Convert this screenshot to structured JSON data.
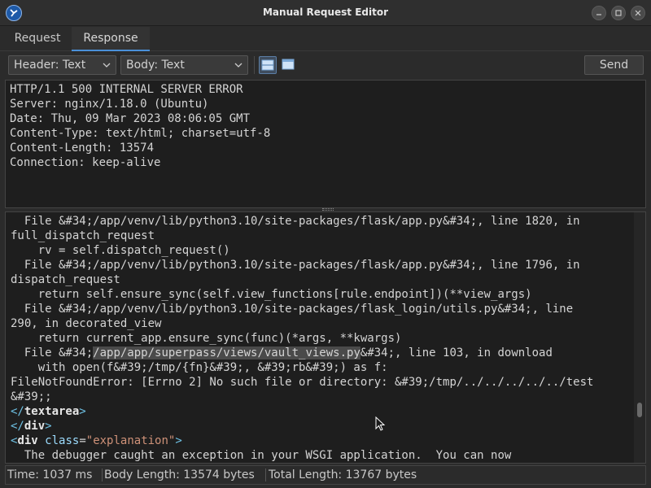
{
  "window": {
    "title": "Manual Request Editor"
  },
  "tabs": [
    {
      "label": "Request"
    },
    {
      "label": "Response"
    }
  ],
  "toolbar": {
    "header_view": "Header: Text",
    "body_view": "Body: Text",
    "send_label": "Send"
  },
  "response_header": {
    "lines": [
      "HTTP/1.1 500 INTERNAL SERVER ERROR",
      "Server: nginx/1.18.0 (Ubuntu)",
      "Date: Thu, 09 Mar 2023 08:06:05 GMT",
      "Content-Type: text/html; charset=utf-8",
      "Content-Length: 13574",
      "Connection: keep-alive"
    ]
  },
  "response_body": {
    "l1": "  File &#34;/app/venv/lib/python3.10/site-packages/flask/app.py&#34;, line 1820, in",
    "l2": "full_dispatch_request",
    "l3": "    rv = self.dispatch_request()",
    "l4": "  File &#34;/app/venv/lib/python3.10/site-packages/flask/app.py&#34;, line 1796, in",
    "l5": "dispatch_request",
    "l6": "    return self.ensure_sync(self.view_functions[rule.endpoint])(**view_args)",
    "l7": "  File &#34;/app/venv/lib/python3.10/site-packages/flask_login/utils.py&#34;, line",
    "l8": "290, in decorated_view",
    "l9": "    return current_app.ensure_sync(func)(*args, **kwargs)",
    "l10_pre": "  File &#34;",
    "l10_hl": "/app/app/superpass/views/vault_views.py",
    "l10_post": "&#34;, line 103, in download",
    "l11": "    with open(f&#39;/tmp/{fn}&#39;, &#39;rb&#39;) as f:",
    "l12": "FileNotFoundError: [Errno 2] No such file or directory: &#39;/tmp/../../../../../test",
    "l13": "&#39;;",
    "l14_open": "</",
    "l14_name": "textarea",
    "l14_close": ">",
    "l15_open": "</",
    "l15_name": "div",
    "l15_close": ">",
    "l16_open": "<",
    "l16_name": "div",
    "l16_attr": "class",
    "l16_eq": "=",
    "l16_val": "\"explanation\"",
    "l16_close": ">",
    "l17": "  The debugger caught an exception in your WSGI application.  You can now"
  },
  "status": {
    "time": "Time: 1037 ms",
    "body_length": "Body Length: 13574 bytes",
    "total_length": "Total Length: 13767 bytes"
  },
  "colors": {
    "accent": "#4a90d9",
    "tag": "#6ec1e4",
    "string": "#ce9178"
  },
  "icons": [
    "app-logo-icon",
    "minimize-icon",
    "maximize-icon",
    "close-icon",
    "chevron-down-icon",
    "split-horizontal-icon",
    "single-pane-icon",
    "mouse-cursor-icon"
  ]
}
